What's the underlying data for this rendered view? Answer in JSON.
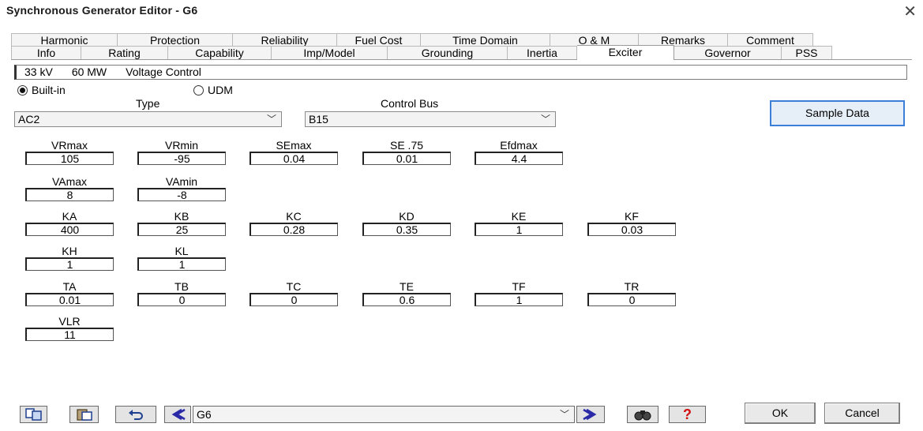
{
  "window": {
    "title": "Synchronous Generator Editor - G6",
    "close_glyph": "✕"
  },
  "tabs_row1": [
    "Harmonic",
    "Protection",
    "Reliability",
    "Fuel Cost",
    "Time Domain",
    "O & M",
    "Remarks",
    "Comment"
  ],
  "tabs_row2": [
    "Info",
    "Rating",
    "Capability",
    "Imp/Model",
    "Grounding",
    "Inertia",
    "Exciter",
    "Governor",
    "PSS"
  ],
  "active_tab": "Exciter",
  "info_bar": {
    "voltage": "33 kV",
    "power": "60 MW",
    "mode": "Voltage Control"
  },
  "model_source": {
    "builtin_label": "Built-in",
    "udm_label": "UDM",
    "selected": "Built-in"
  },
  "type": {
    "label": "Type",
    "value": "AC2"
  },
  "control_bus": {
    "label": "Control Bus",
    "value": "B15"
  },
  "sample_data_button": "Sample Data",
  "params": {
    "VRmax": "105",
    "VRmin": "-95",
    "SEmax": "0.04",
    "SE75": "0.01",
    "Efdmax": "4.4",
    "VAmax": "8",
    "VAmin": "-8",
    "KA": "400",
    "KB": "25",
    "KC": "0.28",
    "KD": "0.35",
    "KE": "1",
    "KF": "0.03",
    "KH": "1",
    "KL": "1",
    "TA": "0.01",
    "TB": "0",
    "TC": "0",
    "TE": "0.6",
    "TF": "1",
    "TR": "0",
    "VLR": "11"
  },
  "param_labels": {
    "VRmax": "VRmax",
    "VRmin": "VRmin",
    "SEmax": "SEmax",
    "SE75": "SE .75",
    "Efdmax": "Efdmax",
    "VAmax": "VAmax",
    "VAmin": "VAmin",
    "KA": "KA",
    "KB": "KB",
    "KC": "KC",
    "KD": "KD",
    "KE": "KE",
    "KF": "KF",
    "KH": "KH",
    "KL": "KL",
    "TA": "TA",
    "TB": "TB",
    "TC": "TC",
    "TE": "TE",
    "TF": "TF",
    "TR": "TR",
    "VLR": "VLR"
  },
  "bottom": {
    "element_value": "G6",
    "ok_label": "OK",
    "cancel_label": "Cancel",
    "icons": [
      "copy-icon",
      "paste-icon",
      "undo-icon",
      "previous-icon",
      "next-icon",
      "find-icon",
      "help-icon"
    ]
  }
}
